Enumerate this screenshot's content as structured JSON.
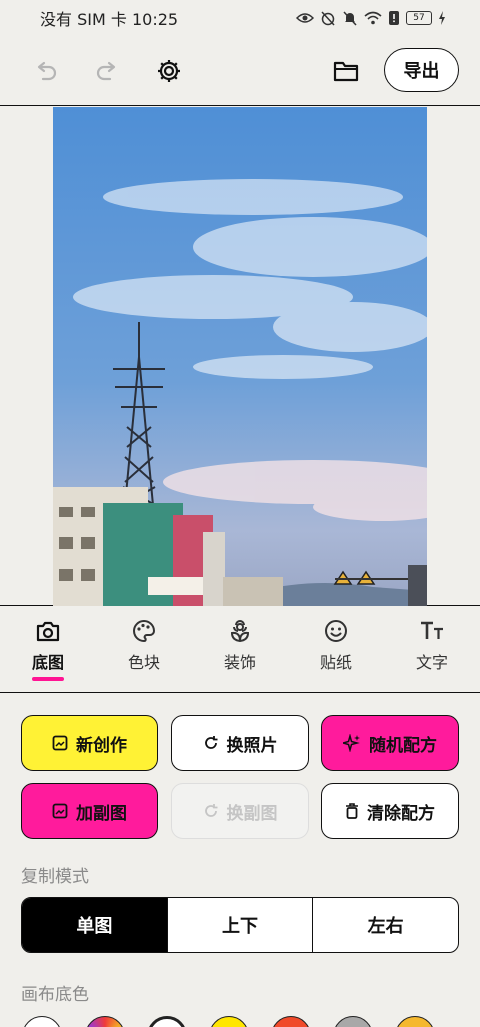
{
  "status_bar": {
    "carrier": "没有 SIM 卡",
    "time": "10:25",
    "battery": "57"
  },
  "toolbar": {
    "export_label": "导出"
  },
  "tabs": [
    {
      "label": "底图",
      "icon": "camera-icon",
      "active": true
    },
    {
      "label": "色块",
      "icon": "palette-icon",
      "active": false
    },
    {
      "label": "装饰",
      "icon": "flower-icon",
      "active": false
    },
    {
      "label": "贴纸",
      "icon": "smiley-icon",
      "active": false
    },
    {
      "label": "文字",
      "icon": "text-size-icon",
      "active": false
    }
  ],
  "actions": {
    "new_creation": "新创作",
    "change_photo": "换照片",
    "random_recipe": "随机配方",
    "add_copy": "加副图",
    "change_copy": "换副图",
    "clear_recipe": "清除配方"
  },
  "copy_mode": {
    "label": "复制模式",
    "options": [
      "单图",
      "上下",
      "左右"
    ],
    "selected": "单图"
  },
  "canvas_bg": {
    "label": "画布底色",
    "swatches": [
      "#ffffff",
      "#5a3df0",
      "#ffffff",
      "#ffe600",
      "#f04a2a",
      "#a8a8a8",
      "#f5b82e"
    ]
  },
  "colors": {
    "accent_pink": "#ff1b9c",
    "accent_yellow": "#fff235"
  }
}
